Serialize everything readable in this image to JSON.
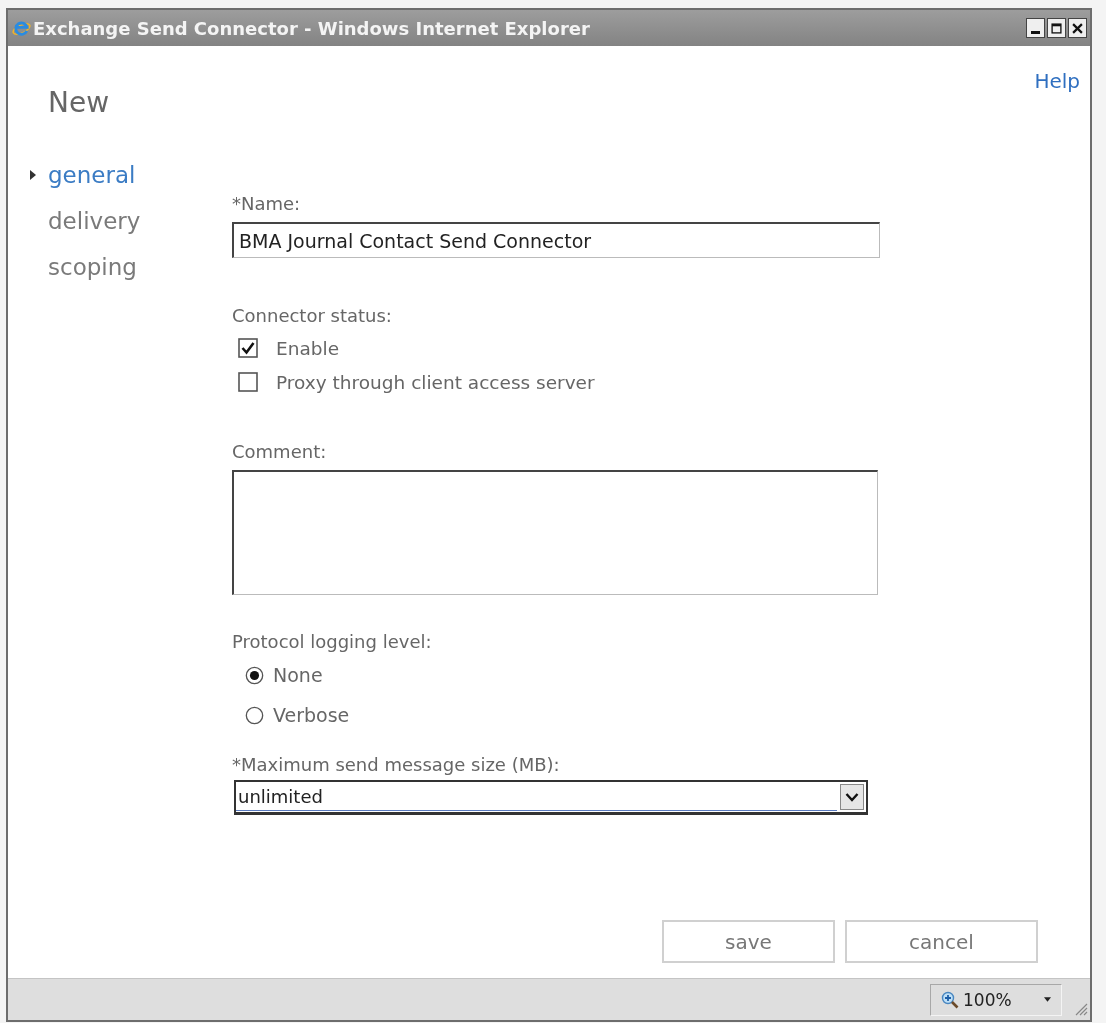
{
  "window": {
    "title": "Exchange Send Connector - Windows Internet Explorer"
  },
  "help_link": "Help",
  "page_title": "New",
  "nav": [
    {
      "label": "general",
      "selected": true
    },
    {
      "label": "delivery",
      "selected": false
    },
    {
      "label": "scoping",
      "selected": false
    }
  ],
  "form": {
    "name": {
      "label": "*Name:",
      "value": "BMA Journal Contact Send Connector"
    },
    "connector_status": {
      "label": "Connector status:",
      "options": [
        {
          "label": "Enable",
          "checked": true
        },
        {
          "label": "Proxy through client access server",
          "checked": false
        }
      ]
    },
    "comment": {
      "label": "Comment:"
    },
    "protocol_logging": {
      "label": "Protocol logging level:",
      "options": [
        {
          "label": "None",
          "selected": true
        },
        {
          "label": "Verbose",
          "selected": false
        }
      ]
    },
    "max_size": {
      "label": "*Maximum send message size (MB):",
      "value": "unlimited"
    }
  },
  "buttons": [
    "save",
    "cancel"
  ],
  "status_bar": {
    "zoom": "100%"
  }
}
